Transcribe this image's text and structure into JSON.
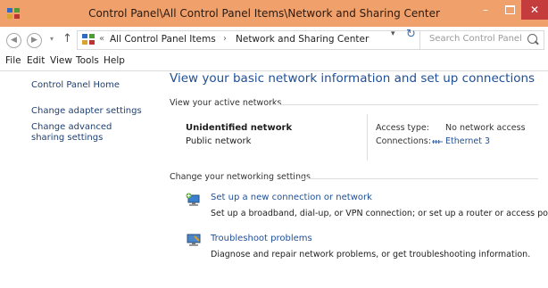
{
  "window": {
    "title": "Control Panel\\All Control Panel Items\\Network and Sharing Center",
    "controls": {
      "minimize": "–",
      "close": "✕"
    }
  },
  "address": {
    "recent": "▾",
    "breadcrumb_sep1": "«",
    "crumb1": "All Control Panel Items",
    "breadcrumb_sep2": "›",
    "crumb2": "Network and Sharing Center",
    "dropdown": "▾",
    "refresh": "↻",
    "search_placeholder": "Search Control Panel"
  },
  "menu": [
    "File",
    "Edit",
    "View",
    "Tools",
    "Help"
  ],
  "sidebar": {
    "home": "Control Panel Home",
    "items": [
      "Change adapter settings",
      "Change advanced sharing settings"
    ]
  },
  "main": {
    "heading": "View your basic network information and set up connections",
    "active_networks_label": "View your active networks",
    "network": {
      "name": "Unidentified network",
      "type": "Public network",
      "access_label": "Access type:",
      "access_value": "No network access",
      "connections_label": "Connections:",
      "connection_name": "Ethernet 3"
    },
    "change_settings_label": "Change your networking settings",
    "tasks": [
      {
        "icon": "new-connection-icon",
        "title": "Set up a new connection or network",
        "desc": "Set up a broadband, dial-up, or VPN connection; or set up a router or access point."
      },
      {
        "icon": "troubleshoot-icon",
        "title": "Troubleshoot problems",
        "desc": "Diagnose and repair network problems, or get troubleshooting information."
      }
    ]
  },
  "colors": {
    "titlebar": "#f0a06a",
    "close": "#c43c3c",
    "link": "#1e4f97",
    "heading": "#1e4f97"
  }
}
